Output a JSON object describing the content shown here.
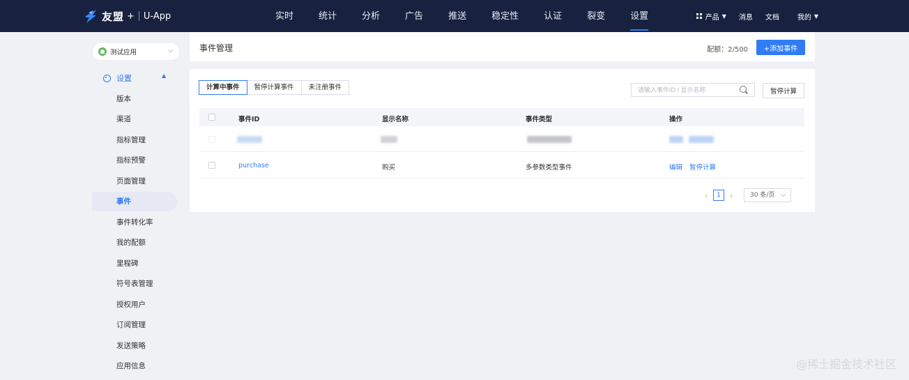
{
  "topbar": {
    "brand": "友盟",
    "plus": "+",
    "app": "U-App",
    "nav": [
      "实时",
      "统计",
      "分析",
      "广告",
      "推送",
      "稳定性",
      "认证",
      "裂变",
      "设置"
    ],
    "active_nav": "设置",
    "products_label": "产品",
    "messages_label": "消息",
    "docs_label": "文档",
    "me_label": "我的"
  },
  "sidebar": {
    "app_name": "测试应用",
    "section_label": "设置",
    "items": [
      "版本",
      "渠道",
      "指标管理",
      "指标预警",
      "页面管理",
      "事件",
      "事件转化率",
      "我的配额",
      "里程碑",
      "符号表管理",
      "授权用户",
      "订阅管理",
      "发送策略",
      "应用信息"
    ],
    "active_item": "事件"
  },
  "header": {
    "title": "事件管理",
    "quota": "配额：2/500",
    "add_button": "+添加事件"
  },
  "tabs": [
    "计算中事件",
    "暂停计算事件",
    "未注册事件"
  ],
  "active_tab": "计算中事件",
  "search": {
    "placeholder": "请输入事件ID / 显示名称"
  },
  "pause_button": "暂停计算",
  "table": {
    "columns": [
      "事件ID",
      "显示名称",
      "事件类型",
      "操作"
    ],
    "rows": [
      {
        "event_id": "",
        "display_name": "",
        "event_type": "",
        "actions": [
          "",
          ""
        ],
        "redacted": true
      },
      {
        "event_id": "purchase",
        "display_name": "购买",
        "event_type": "多参数类型事件",
        "actions": [
          "编辑",
          "暂停计算"
        ],
        "redacted": false
      }
    ]
  },
  "pagination": {
    "current_page": "1",
    "page_size": "30 条/页"
  },
  "watermark": "@稀土掘金技术社区",
  "colors": {
    "topbar": "#18213f",
    "accent": "#2f7cf6",
    "background": "#f0f1f5"
  }
}
